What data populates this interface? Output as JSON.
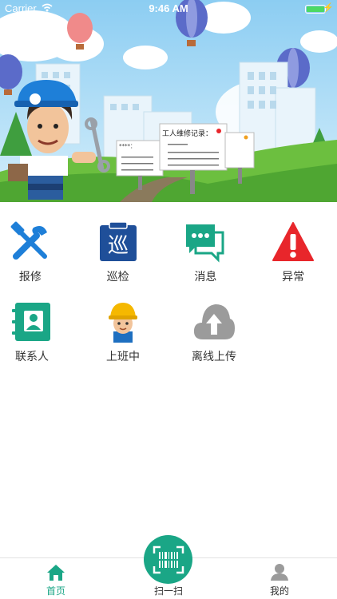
{
  "status_bar": {
    "carrier": "Carrier",
    "time": "9:46 AM"
  },
  "banner": {
    "billboard_title": "工人维修记录：",
    "billboard_small": "****："
  },
  "menu": {
    "row1": [
      {
        "label": "报修",
        "icon": "wrench-hammer-icon"
      },
      {
        "label": "巡检",
        "icon": "clipboard-patrol-icon",
        "glyph": "巡"
      },
      {
        "label": "消息",
        "icon": "chat-bubbles-icon"
      },
      {
        "label": "异常",
        "icon": "warning-triangle-icon"
      }
    ],
    "row2": [
      {
        "label": "联系人",
        "icon": "contacts-book-icon"
      },
      {
        "label": "上班中",
        "icon": "worker-helmet-icon"
      },
      {
        "label": "离线上传",
        "icon": "cloud-upload-icon"
      }
    ]
  },
  "tabbar": {
    "home": "首页",
    "scan": "扫一扫",
    "mine": "我的"
  },
  "colors": {
    "accent": "#1aa686",
    "blue": "#1e7fd8",
    "navy": "#1f4f99",
    "red": "#e8262b",
    "grey": "#9b9b9b"
  }
}
